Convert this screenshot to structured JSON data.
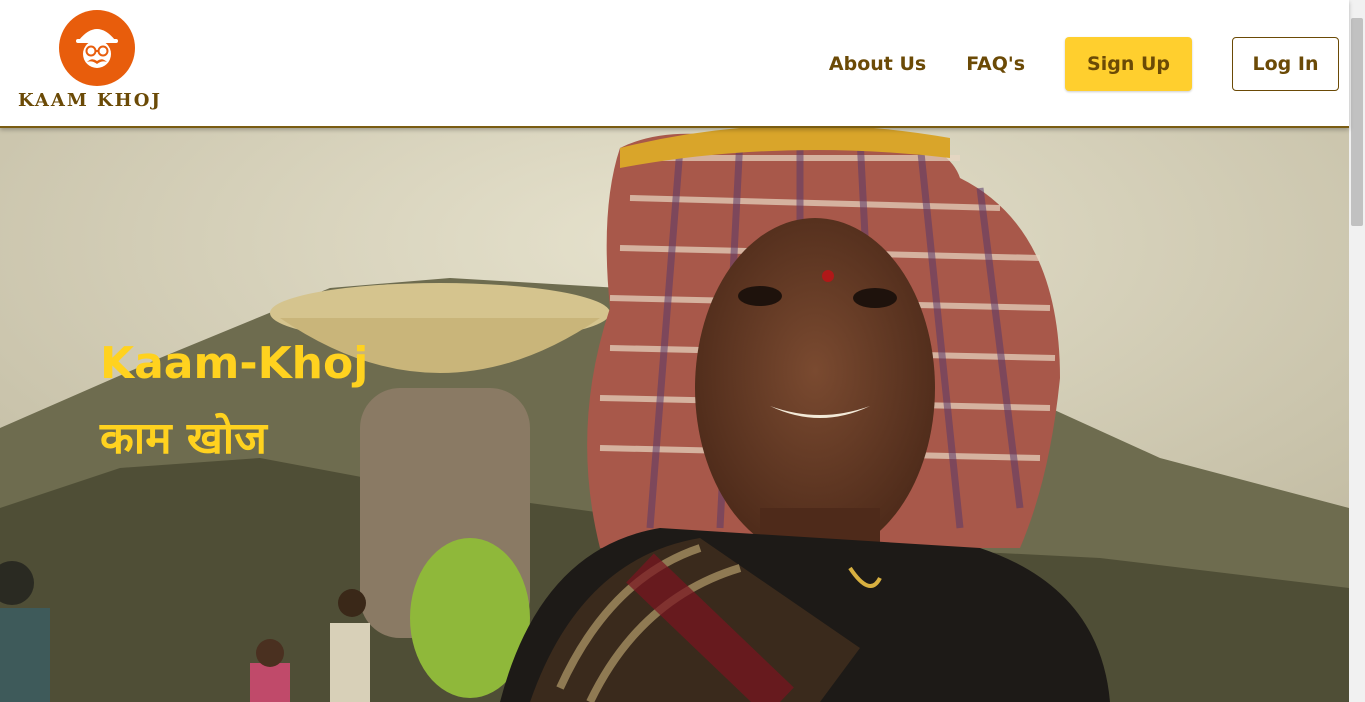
{
  "brand": {
    "logo_text": "KAAM KHOJ",
    "logo_icon": "worker-mascot-icon",
    "logo_color": "#e85d0c"
  },
  "nav": {
    "about": "About Us",
    "faq": "FAQ's",
    "signup": "Sign Up",
    "login": "Log In"
  },
  "hero": {
    "title": "Kaam-Khoj",
    "subtitle": "काम खोज",
    "text_color": "#ffd21f"
  },
  "colors": {
    "primary_brown": "#6b4a06",
    "accent_yellow": "#ffcf2e"
  }
}
